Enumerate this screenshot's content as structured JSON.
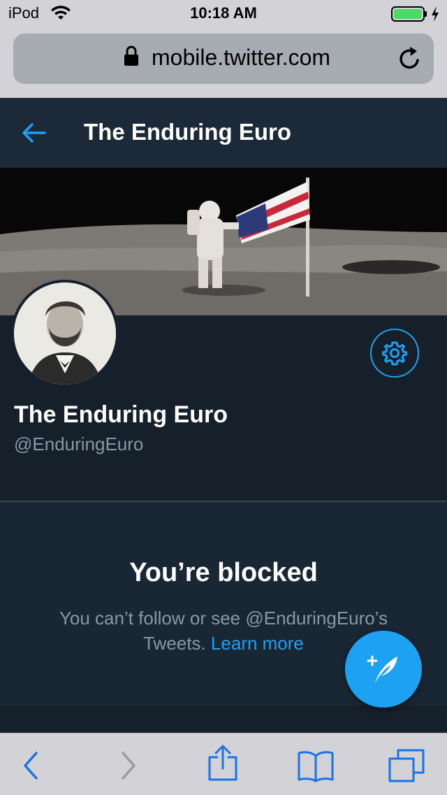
{
  "status_bar": {
    "carrier": "iPod",
    "time": "10:18 AM"
  },
  "browser": {
    "url": "mobile.twitter.com"
  },
  "header": {
    "title": "The Enduring Euro"
  },
  "profile": {
    "name": "The Enduring Euro",
    "handle": "@EnduringEuro"
  },
  "blocked": {
    "title": "You’re blocked",
    "message": "You can’t follow or see @EnduringEuro’s Tweets.",
    "link": "Learn more"
  },
  "colors": {
    "accent": "#1da1f2",
    "background": "#15202b",
    "secondary_text": "#8899a6"
  },
  "icons": {
    "wifi": "wifi-icon",
    "battery": "battery-icon",
    "lock": "lock-icon",
    "reload": "reload-icon",
    "back": "back-arrow-icon",
    "settings": "gear-icon",
    "compose": "compose-icon",
    "share": "share-icon",
    "bookmarks": "book-icon",
    "tabs": "tabs-icon"
  }
}
